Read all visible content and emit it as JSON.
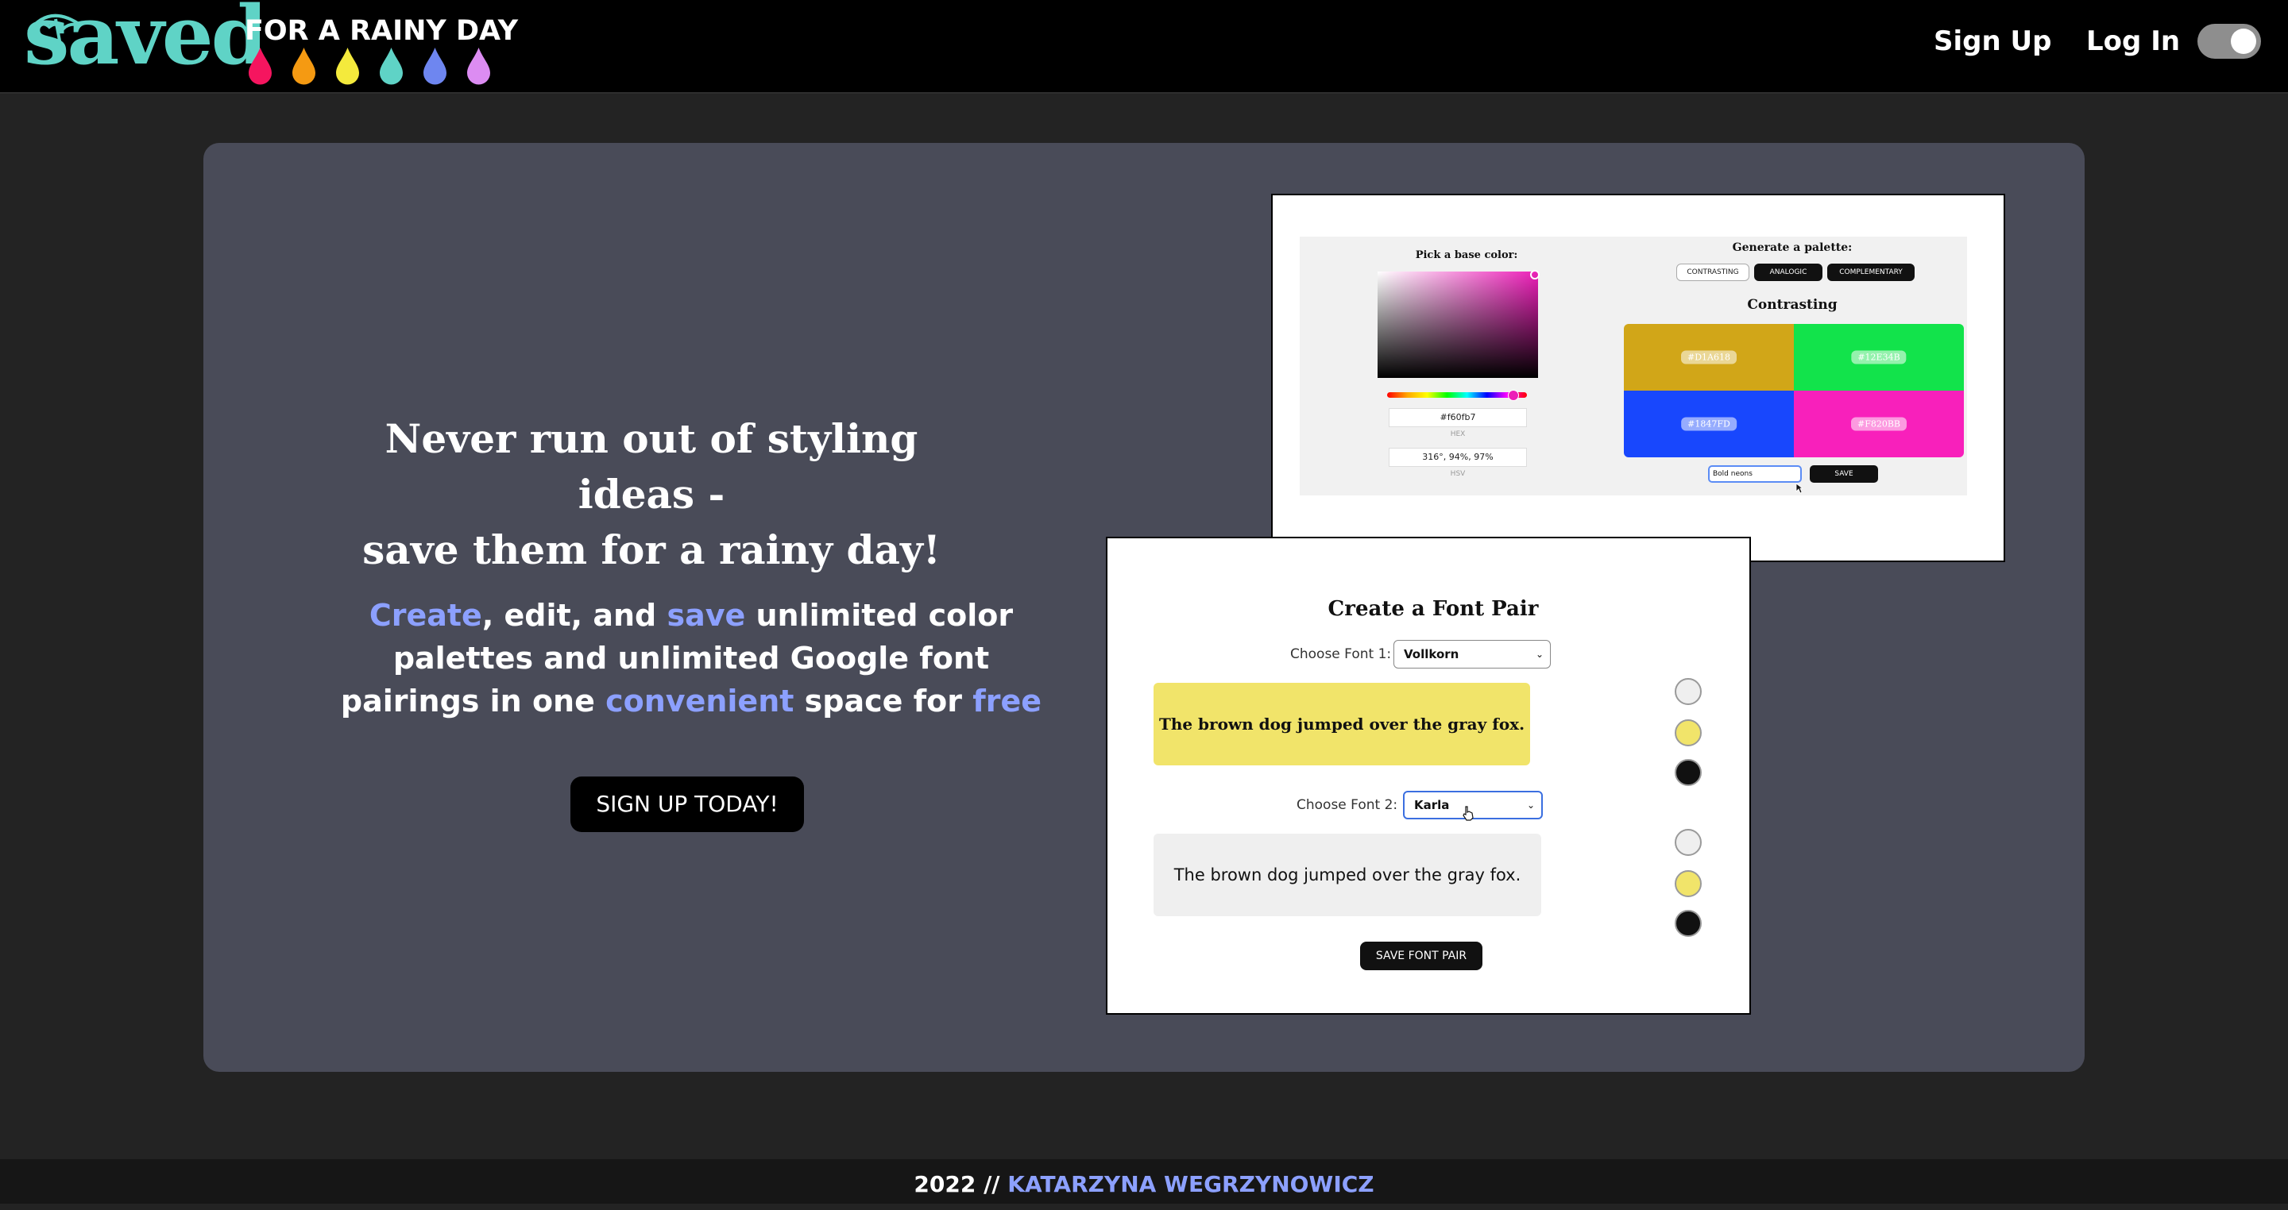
{
  "header": {
    "logo_word": "saved",
    "logo_tagline": "FOR A RAINY DAY",
    "drop_colors": [
      "#f5155f",
      "#f59a12",
      "#f4ea3c",
      "#5fd3c6",
      "#6e86f0",
      "#dc8cf2"
    ],
    "nav": {
      "signup": "Sign Up",
      "login": "Log In"
    },
    "theme_toggle": "on"
  },
  "hero": {
    "title_line1": "Never run out of styling ideas -",
    "title_line2": "save them for a rainy day!",
    "body": {
      "w1": "Create",
      "t1": ", edit, and ",
      "w2": "save",
      "t2": " unlimited color palettes and unlimited Google font pairings in one ",
      "w3": "convenient",
      "t3": " space for ",
      "w4": "free"
    },
    "cta": "SIGN UP TODAY!"
  },
  "palette_shot": {
    "pick_label": "Pick a base color:",
    "hex_value": "#f60fb7",
    "hex_caption": "HEX",
    "hsv_value": "316°, 94%, 97%",
    "hsv_caption": "HSV",
    "generate_label": "Generate a palette:",
    "buttons": [
      "CONTRASTING",
      "ANALOGIC",
      "COMPLEMENTARY"
    ],
    "section_title": "Contrasting",
    "swatches": [
      {
        "hex": "#D1A618",
        "color": "#d1a618"
      },
      {
        "hex": "#12E34B",
        "color": "#12e34b"
      },
      {
        "hex": "#1847FD",
        "color": "#1847fd"
      },
      {
        "hex": "#F820BB",
        "color": "#f820bb"
      }
    ],
    "name_value": "Bold neons",
    "save_label": "SAVE"
  },
  "font_shot": {
    "title": "Create a Font Pair",
    "font1_label": "Choose Font 1:",
    "font1_value": "Vollkorn",
    "font2_label": "Choose Font 2:",
    "font2_value": "Karla",
    "preview_text": "The brown dog jumped over the gray fox.",
    "preview1_bg": "#f1e46a",
    "preview2_bg": "#efefef",
    "dot_colors": [
      "#efefef",
      "#f1e46a",
      "#111111"
    ],
    "save_label": "SAVE FONT PAIR"
  },
  "footer": {
    "year": "2022 //",
    "author": "KATARZYNA WEGRZYNOWICZ"
  }
}
